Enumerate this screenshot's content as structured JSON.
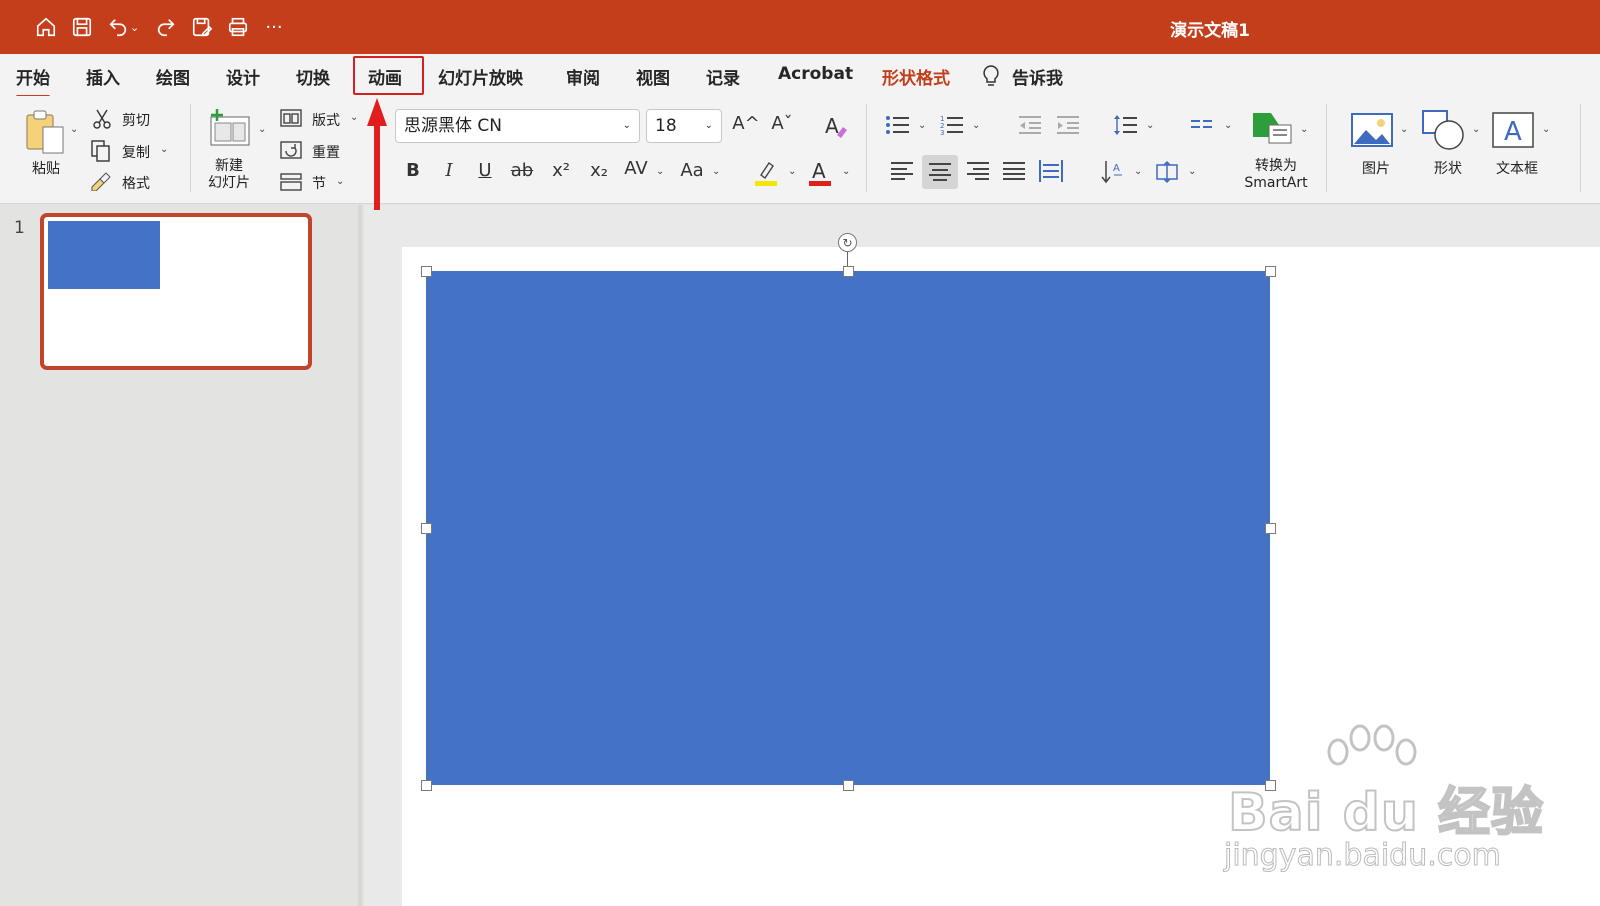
{
  "window": {
    "document_title": "演示文稿1"
  },
  "quick_access": {
    "icons": [
      "home-icon",
      "save-icon",
      "undo-icon",
      "redo-icon",
      "save-as-icon",
      "print-icon",
      "more-icon"
    ]
  },
  "tabs": [
    {
      "label": "开始",
      "active": true
    },
    {
      "label": "插入"
    },
    {
      "label": "绘图"
    },
    {
      "label": "设计"
    },
    {
      "label": "切换"
    },
    {
      "label": "动画",
      "highlighted": true
    },
    {
      "label": "幻灯片放映"
    },
    {
      "label": "审阅"
    },
    {
      "label": "视图"
    },
    {
      "label": "记录"
    },
    {
      "label": "Acrobat"
    },
    {
      "label": "形状格式",
      "contextual": true
    },
    {
      "label": "告诉我"
    }
  ],
  "ribbon": {
    "clipboard": {
      "paste": "粘贴",
      "cut": "剪切",
      "copy": "复制",
      "format_painter": "格式"
    },
    "slides": {
      "new_slide": "新建",
      "new_slide_line2": "幻灯片",
      "layout": "版式",
      "reset": "重置",
      "section": "节"
    },
    "font": {
      "name": "思源黑体 CN",
      "size": "18",
      "bold": "B",
      "italic": "I",
      "underline": "U",
      "strike": "ab",
      "superscript": "x²",
      "subscript": "x₂",
      "spacing": "AV",
      "change_case": "Aa",
      "grow": "A^",
      "shrink": "Aˇ"
    },
    "paragraph": {
      "smartart_line1": "转换为",
      "smartart_line2": "SmartArt"
    },
    "insert": {
      "picture": "图片",
      "shape": "形状",
      "textbox": "文本框"
    }
  },
  "slides_panel": {
    "slide_number": "1"
  },
  "colors": {
    "accent": "#c43e1c",
    "shape_fill": "#4472c4",
    "highlight_yellow": "#f5e600",
    "font_red": "#e0201d",
    "annotation_red": "#d32121"
  },
  "watermark": {
    "brand": "Bai du 经验",
    "url": "jingyan.baidu.com"
  }
}
